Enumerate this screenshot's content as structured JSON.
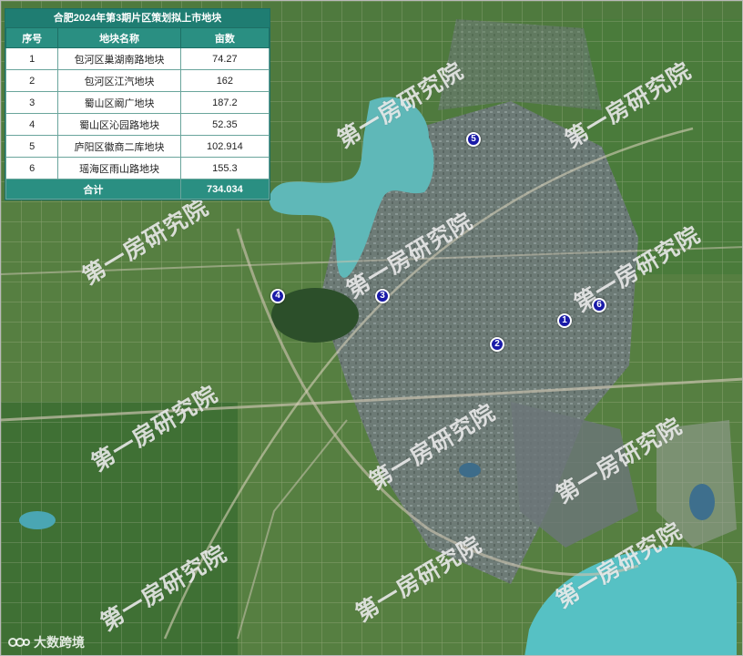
{
  "table": {
    "title": "合肥2024年第3期片区策划拟上市地块",
    "headers": {
      "index": "序号",
      "name": "地块名称",
      "area": "亩数"
    },
    "rows": [
      {
        "index": "1",
        "name": "包河区巢湖南路地块",
        "area": "74.27"
      },
      {
        "index": "2",
        "name": "包河区江汽地块",
        "area": "162"
      },
      {
        "index": "3",
        "name": "蜀山区阚广地块",
        "area": "187.2"
      },
      {
        "index": "4",
        "name": "蜀山区沁园路地块",
        "area": "52.35"
      },
      {
        "index": "5",
        "name": "庐阳区徽商二库地块",
        "area": "102.914"
      },
      {
        "index": "6",
        "name": "瑶海区雨山路地块",
        "area": "155.3"
      }
    ],
    "total": {
      "label": "合计",
      "area": "734.034"
    }
  },
  "markers": [
    {
      "label": "1"
    },
    {
      "label": "2"
    },
    {
      "label": "3"
    },
    {
      "label": "4"
    },
    {
      "label": "5"
    },
    {
      "label": "6"
    }
  ],
  "watermark": "第一房研究院",
  "logo_text": "大数跨境",
  "colors": {
    "table_header": "#2a8f82",
    "marker": "#1a1aa8",
    "lake": "#5fb8b8"
  }
}
